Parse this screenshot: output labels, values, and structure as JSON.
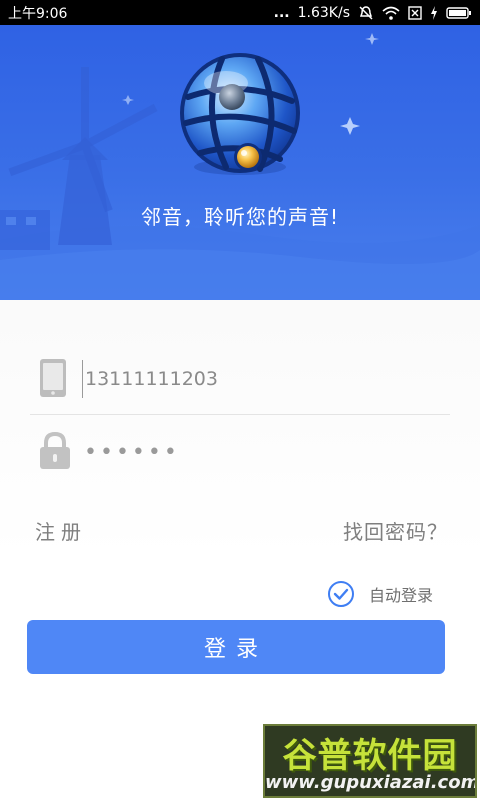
{
  "status_bar": {
    "time": "上午9:06",
    "dots": "...",
    "network_speed": "1.63K/s",
    "icons": [
      "mute-icon",
      "wifi-icon",
      "sim-icon",
      "charging-icon",
      "battery-icon"
    ]
  },
  "header": {
    "logo_icon": "globe-logo-icon",
    "slogan": "邻音，聆听您的声音!"
  },
  "login_form": {
    "phone_icon": "phone-icon",
    "phone_value": "13111111203",
    "lock_icon": "lock-icon",
    "password_value": "••••••",
    "register_link": "注册",
    "forgot_password_link": "找回密码？",
    "auto_login": {
      "label": "自动登录",
      "checked": true,
      "icon": "check-circle-icon"
    },
    "login_button": "登录"
  },
  "watermark": {
    "title": "谷普软件园",
    "url": "www.gupuxiazai.com"
  },
  "colors": {
    "header_blue": "#3a6fe7",
    "button_blue": "#4f87f6",
    "check_blue": "#3f7ef3",
    "text_gray": "#7f7f7f"
  }
}
